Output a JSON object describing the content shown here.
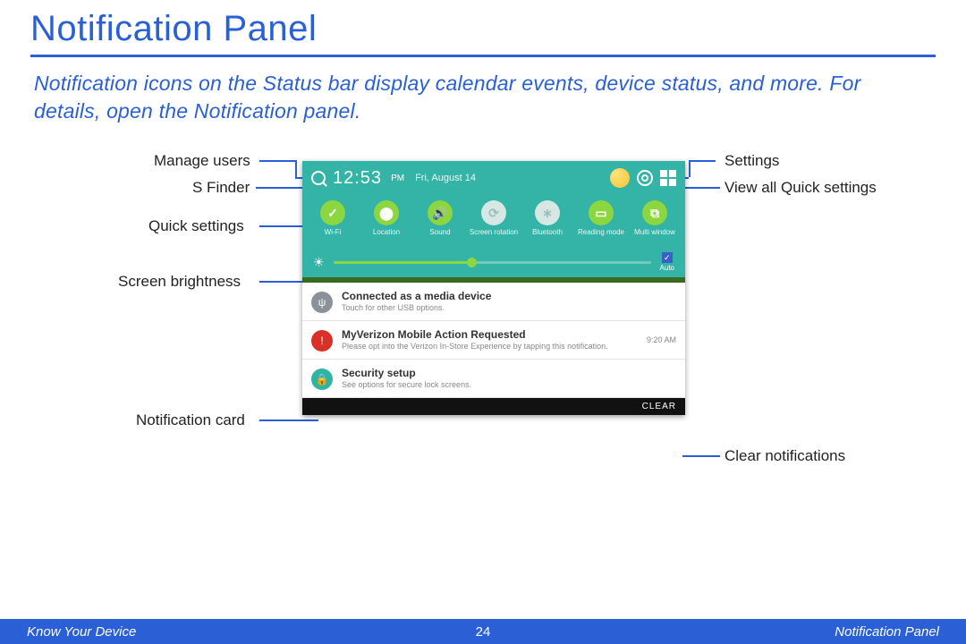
{
  "title": "Notification Panel",
  "intro": "Notification icons on the Status bar display calendar events, device status, and more. For details, open the Notification panel.",
  "statusbar": {
    "time": "12:53",
    "ampm": "PM",
    "date": "Fri, August 14"
  },
  "qs": [
    {
      "label": "Wi-Fi",
      "glyph": "✓",
      "on": true
    },
    {
      "label": "Location",
      "glyph": "⬤",
      "on": true
    },
    {
      "label": "Sound",
      "glyph": "🔊",
      "on": true
    },
    {
      "label": "Screen rotation",
      "glyph": "⟳",
      "on": false
    },
    {
      "label": "Bluetooth",
      "glyph": "∗",
      "on": false
    },
    {
      "label": "Reading mode",
      "glyph": "▭",
      "on": true
    },
    {
      "label": "Multi window",
      "glyph": "⧉",
      "on": true
    }
  ],
  "brightness_auto": "Auto",
  "notifs": [
    {
      "icon": "usb",
      "title": "Connected as a media device",
      "sub": "Touch for other USB options.",
      "time": ""
    },
    {
      "icon": "vz",
      "title": "MyVerizon Mobile Action Requested",
      "sub": "Please opt into the Verizon In-Store Experience by tapping this notification.",
      "time": "9:20 AM"
    },
    {
      "icon": "sec",
      "title": "Security setup",
      "sub": "See options for secure lock screens.",
      "time": ""
    }
  ],
  "clear": "CLEAR",
  "callouts": {
    "manage_users": "Manage users",
    "s_finder": "S Finder",
    "quick_settings": "Quick settings",
    "screen_brightness": "Screen brightness",
    "notification_card": "Notification card",
    "settings": "Settings",
    "view_all": "View all Quick settings",
    "clear_notifications": "Clear notifications"
  },
  "footer": {
    "left": "Know Your Device",
    "page": "24",
    "right": "Notification Panel"
  }
}
